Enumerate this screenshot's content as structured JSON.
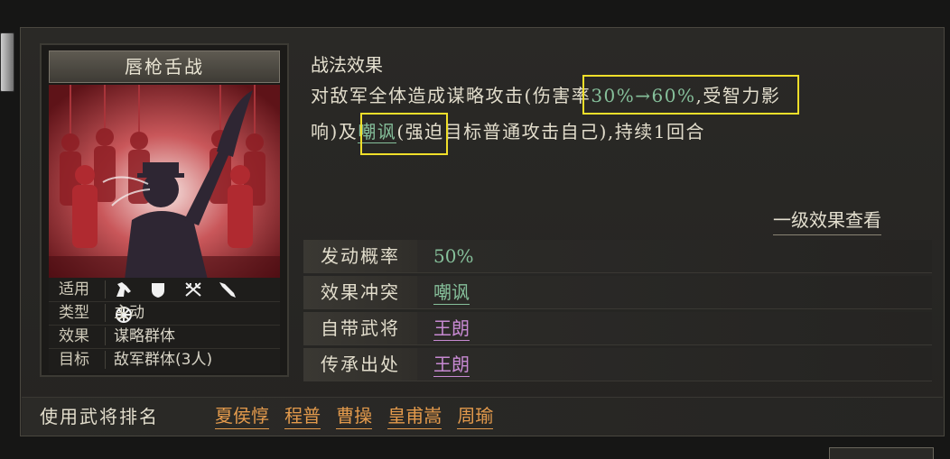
{
  "card": {
    "name": "唇枪舌战",
    "applicable_label": "适用",
    "applicable_icons": [
      "horse-icon",
      "shield-icon",
      "crossed-bows-icon",
      "spear-icon",
      "wheel-icon"
    ],
    "type_label": "类型",
    "type_value": "主动",
    "effect_label": "效果",
    "effect_value": "谋略群体",
    "target_label": "目标",
    "target_value": "敌军群体(3人)"
  },
  "effect": {
    "title": "战法效果",
    "line1_pre": "对敌军全体造成谋略攻击",
    "line1_paren_open": "(",
    "line1_damage_label": "伤害率",
    "line1_damage_value": "30%→60%",
    "line1_post": ",受智力影",
    "line2_pre": "响)及",
    "line2_status": "嘲讽",
    "line2_post": "(强迫目标普通攻击自己),持续1回合",
    "level_link": "一级效果查看"
  },
  "info_rows": [
    {
      "label": "发动概率",
      "value": "50%"
    },
    {
      "label": "效果冲突",
      "value": "嘲讽"
    },
    {
      "label": "自带武将",
      "value": "王朗"
    },
    {
      "label": "传承出处",
      "value": "王朗"
    }
  ],
  "ranking": {
    "label": "使用武将排名",
    "names": [
      "夏侯惇",
      "程普",
      "曹操",
      "皇甫嵩",
      "周瑜"
    ]
  },
  "colors": {
    "highlight_green": "#86c09b",
    "highlight_purple": "#c789d2",
    "rank_orange": "#e39a4c",
    "annotation_box": "#f0df2a"
  }
}
